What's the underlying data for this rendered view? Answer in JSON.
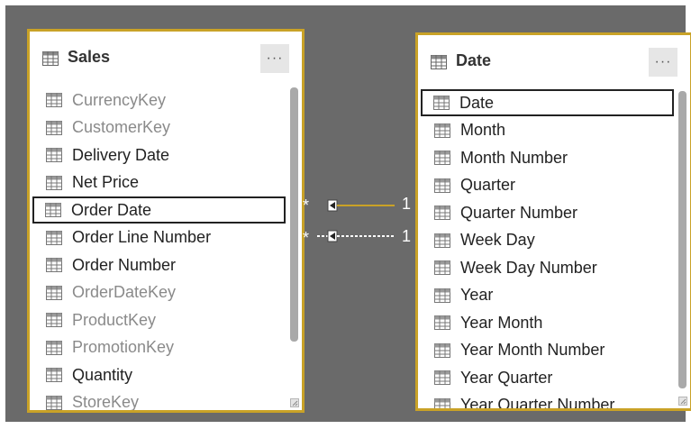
{
  "sales_table": {
    "title": "Sales",
    "more_label": "···",
    "fields": [
      {
        "label": "CurrencyKey",
        "hidden": true
      },
      {
        "label": "CustomerKey",
        "hidden": true
      },
      {
        "label": "Delivery Date",
        "hidden": false
      },
      {
        "label": "Net Price",
        "hidden": false
      },
      {
        "label": "Order Date",
        "hidden": false,
        "selected": true
      },
      {
        "label": "Order Line Number",
        "hidden": false
      },
      {
        "label": "Order Number",
        "hidden": false
      },
      {
        "label": "OrderDateKey",
        "hidden": true
      },
      {
        "label": "ProductKey",
        "hidden": true
      },
      {
        "label": "PromotionKey",
        "hidden": true
      },
      {
        "label": "Quantity",
        "hidden": false
      },
      {
        "label": "StoreKey",
        "hidden": true
      }
    ]
  },
  "date_table": {
    "title": "Date",
    "more_label": "···",
    "fields": [
      {
        "label": "Date",
        "hidden": false,
        "selected": true
      },
      {
        "label": "Month",
        "hidden": false
      },
      {
        "label": "Month Number",
        "hidden": false
      },
      {
        "label": "Quarter",
        "hidden": false
      },
      {
        "label": "Quarter Number",
        "hidden": false
      },
      {
        "label": "Week Day",
        "hidden": false
      },
      {
        "label": "Week Day Number",
        "hidden": false
      },
      {
        "label": "Year",
        "hidden": false
      },
      {
        "label": "Year Month",
        "hidden": false
      },
      {
        "label": "Year Month Number",
        "hidden": false
      },
      {
        "label": "Year Quarter",
        "hidden": false
      },
      {
        "label": "Year Quarter Number",
        "hidden": false
      }
    ]
  },
  "relationships": [
    {
      "from_cardinality": "*",
      "to_cardinality": "1",
      "active": true
    },
    {
      "from_cardinality": "*",
      "to_cardinality": "1",
      "active": false
    }
  ],
  "colors": {
    "canvas": "#6a6a6a",
    "selected_table_border": "#c9a227",
    "active_relationship": "#c9a227",
    "inactive_relationship": "#ffffff"
  },
  "icons": {
    "table": "table-grid-icon",
    "field": "column-field-icon",
    "more": "ellipsis-icon",
    "resize": "resize-grip-icon",
    "filter_direction": "filter-arrow-icon"
  }
}
